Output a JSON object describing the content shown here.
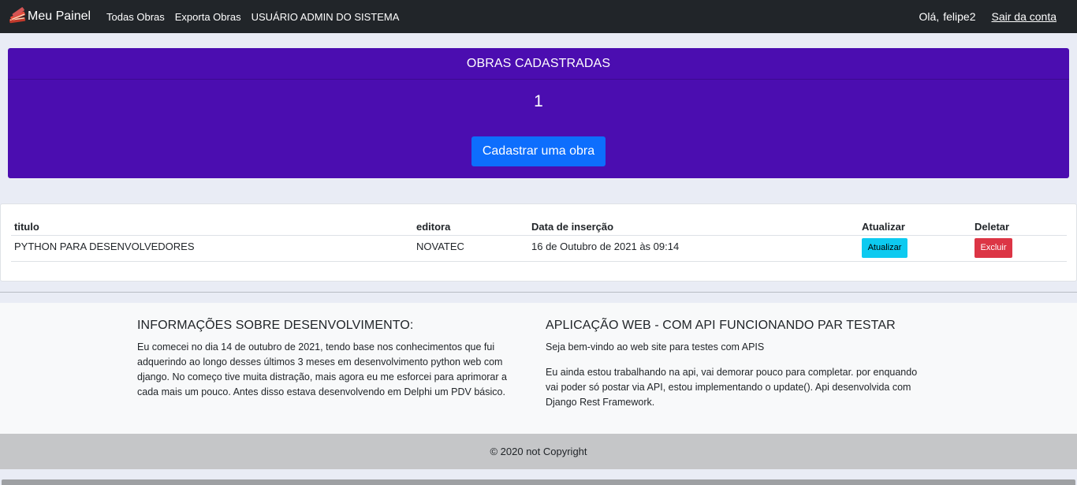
{
  "navbar": {
    "brand": "Meu Painel",
    "brand_icon": "books-icon",
    "links": [
      "Todas Obras",
      "Exporta Obras",
      "USUÁRIO ADMIN DO SISTEMA"
    ],
    "greeting": "Olá,",
    "username": "felipe2",
    "logout": "Sair da conta"
  },
  "counter": {
    "header": "OBRAS CADASTRADAS",
    "value": "1",
    "button": "Cadastrar uma obra",
    "bg_color": "#4b0db0",
    "button_color": "#0d6efd"
  },
  "table": {
    "headers": [
      "titulo",
      "editora",
      "Data de inserção",
      "Atualizar",
      "Deletar"
    ],
    "rows": [
      {
        "titulo": "PYTHON PARA DESENVOLVEDORES",
        "editora": "NOVATEC",
        "data": "16 de Outubro de 2021 às 09:14",
        "update_label": "Atualizar",
        "delete_label": "Excluir"
      }
    ]
  },
  "info": {
    "left": {
      "title": "INFORMAÇÕES SOBRE DESENVOLVIMENTO:",
      "text": "Eu comecei no dia 14 de outubro de 2021, tendo base nos conhecimentos que fui adquerindo ao longo desses últimos 3 meses em desenvolvimento python web com django. No começo tive muita distração, mais agora eu me esforcei para aprimorar a cada mais um pouco. Antes disso estava desenvolvendo em Delphi um PDV básico."
    },
    "right": {
      "title": "APLICAÇÃO WEB - COM API FUNCIONANDO PAR TESTAR",
      "text1": "Seja bem-vindo ao web site para testes com APIS",
      "text2": "Eu ainda estou trabalhando na api, vai demorar pouco para completar. por enquando vai poder só postar via API, estou implementando o update(). Api desenvolvida com Django Rest Framework."
    }
  },
  "footer": {
    "text": "© 2020 not Copyright"
  }
}
